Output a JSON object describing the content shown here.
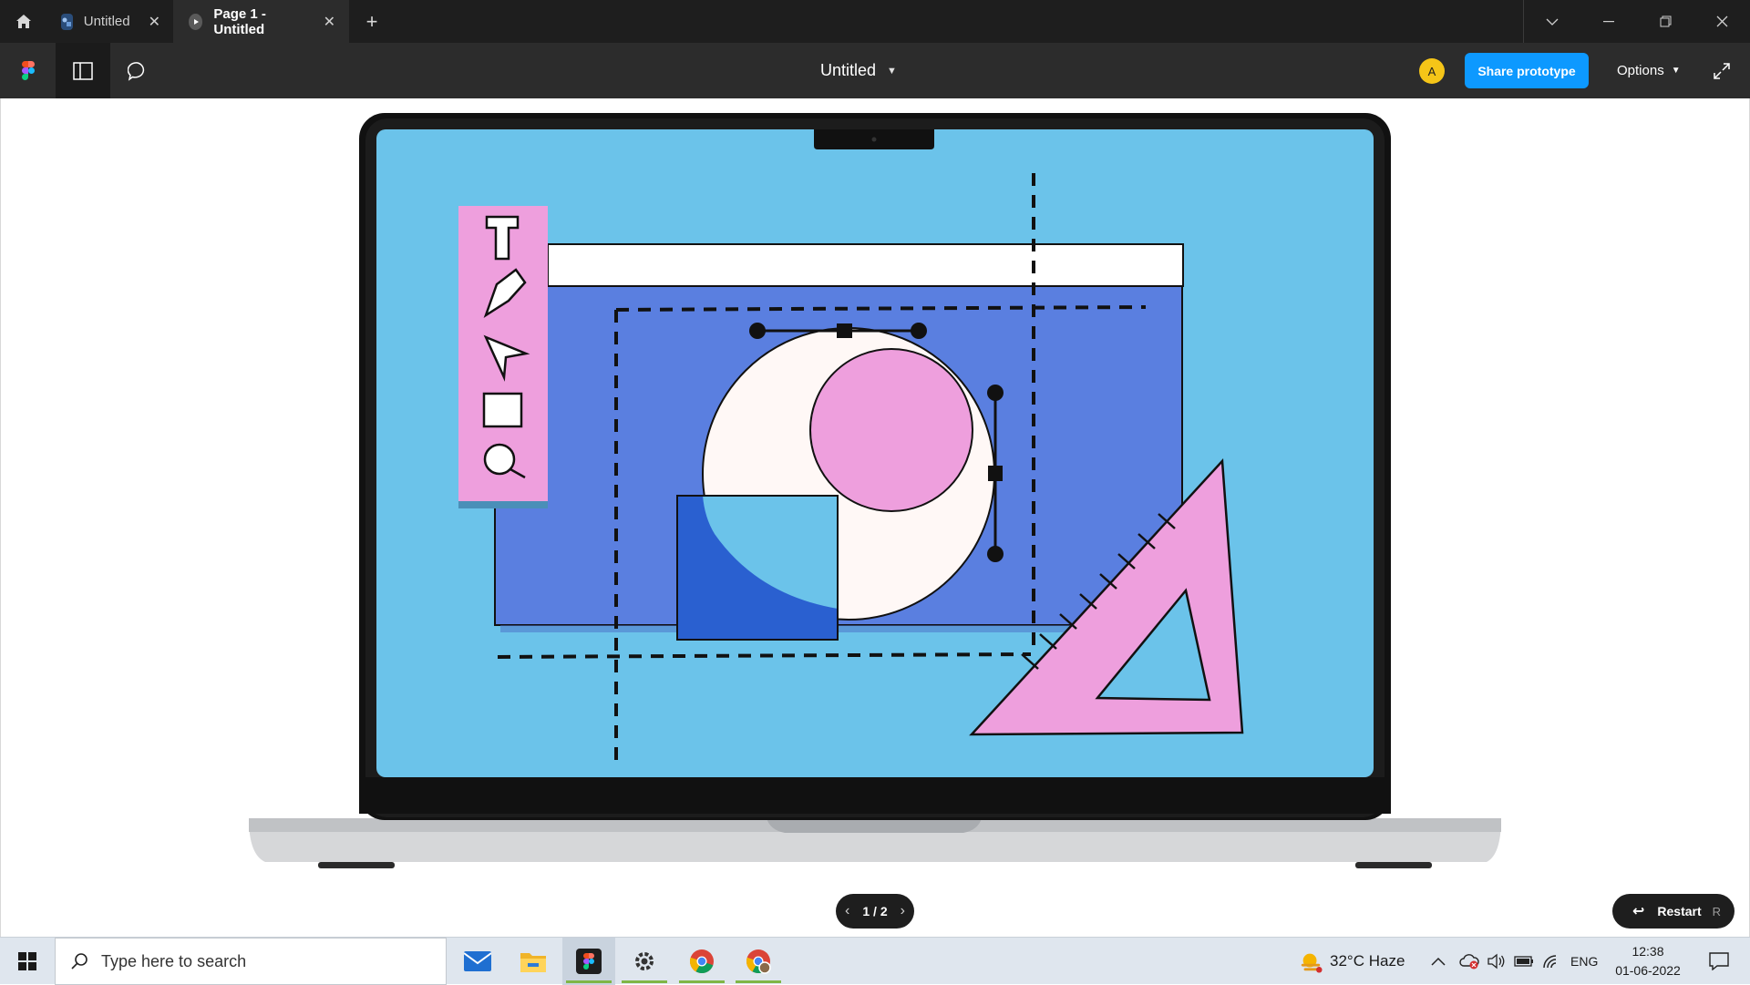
{
  "window": {
    "tabs": [
      {
        "label": "Untitled",
        "icon": "figma-file-icon",
        "active": false
      },
      {
        "label": "Page 1 - Untitled",
        "icon": "play-icon",
        "active": true
      }
    ],
    "new_tab_icon": "plus-icon",
    "controls": [
      "chevron-down-icon",
      "minimize-icon",
      "restore-icon",
      "close-icon"
    ]
  },
  "toolbar": {
    "file_title": "Untitled",
    "avatar_initial": "A",
    "share_label": "Share prototype",
    "options_label": "Options",
    "colors": {
      "share": "#0d99ff",
      "avatar": "#f5c518"
    }
  },
  "prototype": {
    "pager_label": "1 / 2",
    "restart_label": "Restart",
    "restart_shortcut": "R"
  },
  "taskbar": {
    "search_placeholder": "Type here to search",
    "apps": [
      "mail-icon",
      "file-explorer-icon",
      "figma-icon",
      "settings-icon",
      "chrome-icon",
      "chrome-profile-icon"
    ],
    "weather": "32°C  Haze",
    "language": "ENG",
    "time": "12:38",
    "date": "01-06-2022"
  }
}
